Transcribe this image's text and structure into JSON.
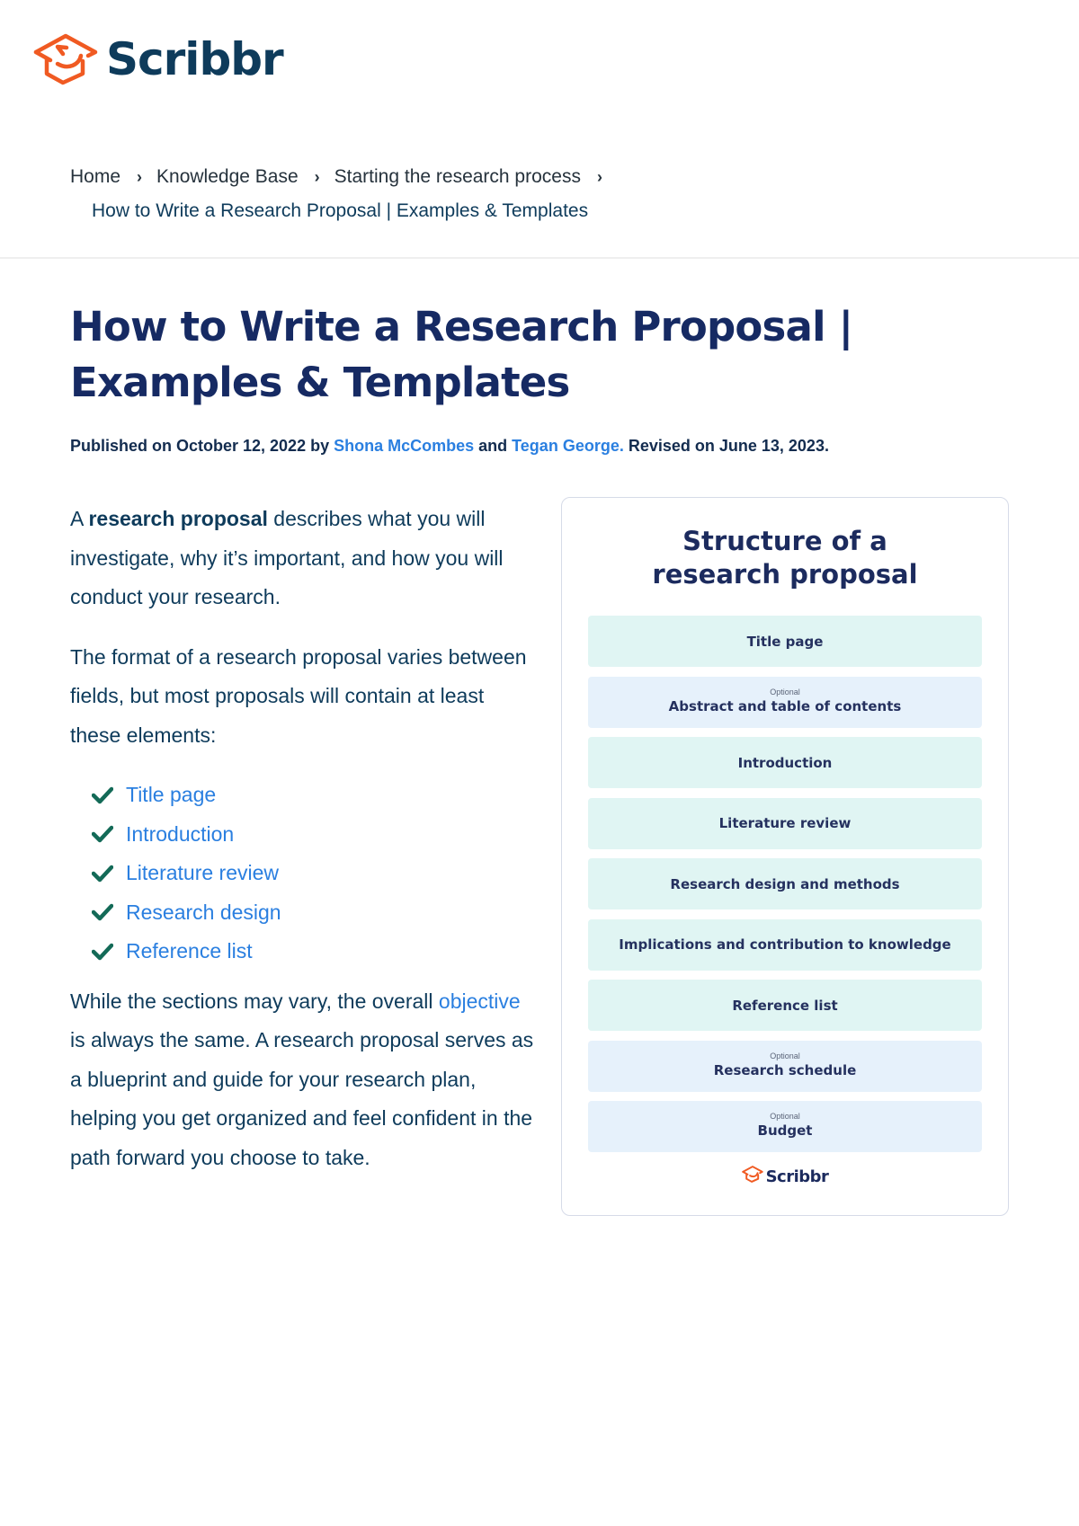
{
  "brand": {
    "name": "Scribbr",
    "accent_color": "#f05a22",
    "text_color": "#0e3b5b"
  },
  "breadcrumb": {
    "items": [
      "Home",
      "Knowledge Base",
      "Starting the research process"
    ],
    "separator": "›",
    "current": "How to Write a Research Proposal | Examples & Templates"
  },
  "article": {
    "title_line1": "How to Write a Research Proposal |",
    "title_line2": "Examples & Templates",
    "byline": {
      "published_prefix": "Published on October 12, 2022 by ",
      "author1": "Shona McCombes",
      "conjunction": " and ",
      "author2": "Tegan George.",
      "revised": " Revised on June 13, 2023."
    },
    "intro": {
      "prefix": "A ",
      "bold": "research proposal",
      "suffix": " describes what you will investigate, why it’s important, and how you will conduct your research."
    },
    "format_paragraph": "The format of a research proposal varies between fields, but most proposals will contain at least these elements:",
    "checklist": [
      "Title page",
      "Introduction",
      "Literature review",
      "Research design",
      "Reference list"
    ],
    "closing": {
      "prefix": "While the sections may vary, the overall ",
      "link": "objective",
      "suffix": " is always the same. A research proposal serves as a blueprint and guide for your research plan, helping you get organized and feel confident in the path forward you choose to take."
    }
  },
  "infographic": {
    "title_line1": "Structure of a",
    "title_line2": "research proposal",
    "optional_tag": "Optional",
    "sections": [
      {
        "label": "Title page",
        "optional": false
      },
      {
        "label": "Abstract and table of contents",
        "optional": true
      },
      {
        "label": "Introduction",
        "optional": false
      },
      {
        "label": "Literature review",
        "optional": false
      },
      {
        "label": "Research design and methods",
        "optional": false
      },
      {
        "label": "Implications and contribution to knowledge",
        "optional": false
      },
      {
        "label": "Reference list",
        "optional": false
      },
      {
        "label": "Research schedule",
        "optional": true
      },
      {
        "label": "Budget",
        "optional": true
      }
    ],
    "footer_brand": "Scribbr",
    "colors": {
      "required_bg": "#e0f5f3",
      "optional_bg": "#e6f1fb"
    }
  }
}
